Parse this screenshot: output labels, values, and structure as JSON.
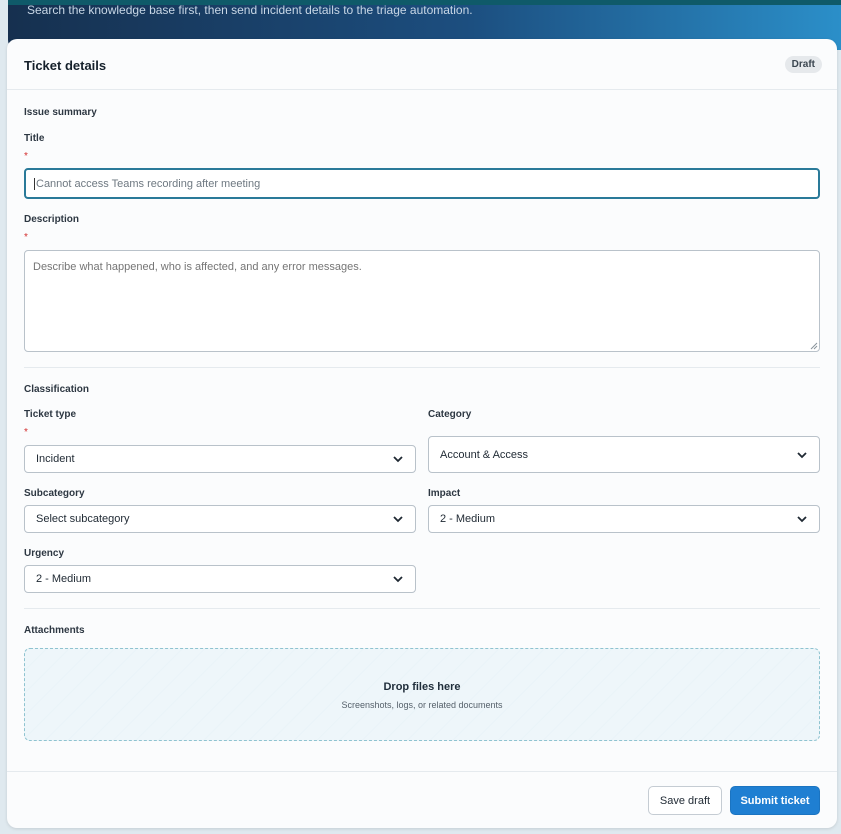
{
  "banner": {
    "subtitle": "Search the knowledge base first, then send incident details to the triage automation."
  },
  "card": {
    "title": "Ticket details",
    "status_badge": "Draft"
  },
  "issue_summary": {
    "heading": "Issue summary",
    "title_label": "Title",
    "title_placeholder": "Cannot access Teams recording after meeting",
    "description_label": "Description",
    "description_placeholder": "Describe what happened, who is affected, and any error messages.",
    "required_mark": "*"
  },
  "classification": {
    "heading": "Classification",
    "ticket_type_label": "Ticket type",
    "ticket_type_value": "Incident",
    "category_label": "Category",
    "category_value": "Account & Access",
    "subcategory_label": "Subcategory",
    "subcategory_value": "Select subcategory",
    "impact_label": "Impact",
    "impact_value": "2 - Medium",
    "urgency_label": "Urgency",
    "urgency_value": "2 - Medium",
    "required_mark": "*"
  },
  "attachments": {
    "heading": "Attachments",
    "drop_title": "Drop files here",
    "drop_subtitle": "Screenshots, logs, or related documents"
  },
  "footer": {
    "save_label": "Save draft",
    "submit_label": "Submit ticket"
  },
  "colors": {
    "primary": "#1f7fd2",
    "focus": "#2a7a99",
    "required": "#d32f2f"
  }
}
